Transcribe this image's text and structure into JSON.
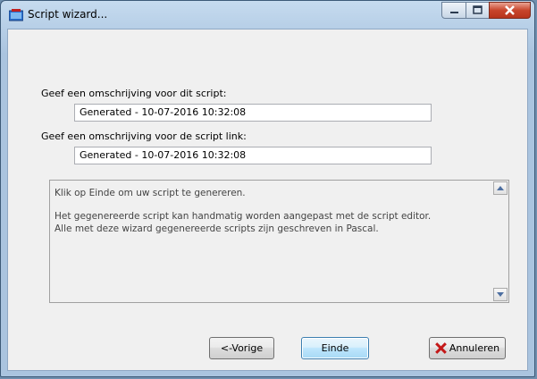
{
  "window": {
    "title": "Script wizard..."
  },
  "form": {
    "description_label": "Geef een omschrijving voor dit script:",
    "description_value": "Generated - 10-07-2016 10:32:08",
    "link_label": "Geef een omschrijving voor de script link:",
    "link_value": "Generated - 10-07-2016 10:32:08"
  },
  "info": {
    "line1": "Klik op Einde om uw script te genereren.",
    "line2": "Het gegenereerde script kan handmatig worden aangepast met de script editor.",
    "line3": "Alle met deze wizard gegenereerde scripts zijn geschreven in Pascal."
  },
  "buttons": {
    "previous": "<-Vorige",
    "finish": "Einde",
    "cancel": "Annuleren"
  }
}
